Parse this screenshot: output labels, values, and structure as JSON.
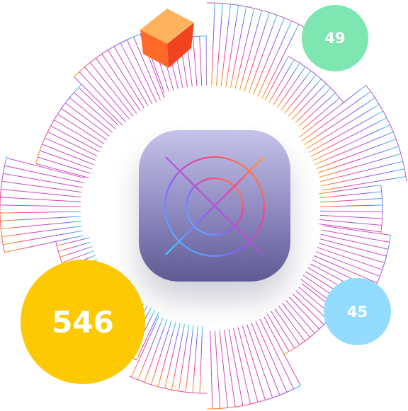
{
  "badges": {
    "top_right": {
      "value": "49",
      "color": "#7ee6b0"
    },
    "bottom_right": {
      "value": "45",
      "color": "#94dcff"
    },
    "bottom_left": {
      "value": "546",
      "color": "#fcc902"
    }
  },
  "center_tile": {
    "icon": "gradient-crosshair-logo-icon"
  },
  "decoration": {
    "cube_icon": "orange-cube-icon"
  },
  "colors": {
    "ring_gradient": [
      "#ff9d00",
      "#ff3d7f",
      "#c04bd0",
      "#6b63f5",
      "#2fd6de"
    ],
    "tile_top": "#c6c3ea",
    "tile_bottom": "#5e5a92",
    "cube": "#ff5a2a"
  }
}
